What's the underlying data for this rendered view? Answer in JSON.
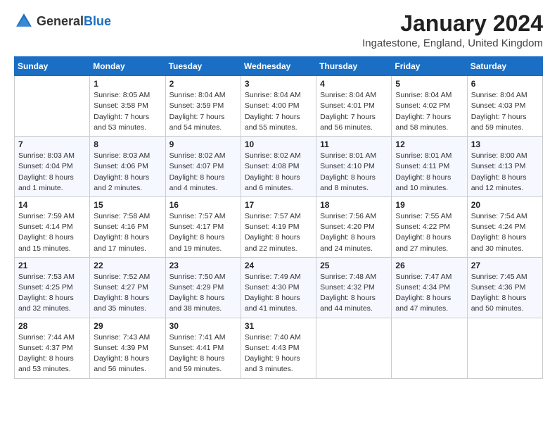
{
  "header": {
    "logo_general": "General",
    "logo_blue": "Blue",
    "month_title": "January 2024",
    "location": "Ingatestone, England, United Kingdom"
  },
  "calendar": {
    "days_of_week": [
      "Sunday",
      "Monday",
      "Tuesday",
      "Wednesday",
      "Thursday",
      "Friday",
      "Saturday"
    ],
    "weeks": [
      [
        {
          "day": "",
          "info": ""
        },
        {
          "day": "1",
          "info": "Sunrise: 8:05 AM\nSunset: 3:58 PM\nDaylight: 7 hours\nand 53 minutes."
        },
        {
          "day": "2",
          "info": "Sunrise: 8:04 AM\nSunset: 3:59 PM\nDaylight: 7 hours\nand 54 minutes."
        },
        {
          "day": "3",
          "info": "Sunrise: 8:04 AM\nSunset: 4:00 PM\nDaylight: 7 hours\nand 55 minutes."
        },
        {
          "day": "4",
          "info": "Sunrise: 8:04 AM\nSunset: 4:01 PM\nDaylight: 7 hours\nand 56 minutes."
        },
        {
          "day": "5",
          "info": "Sunrise: 8:04 AM\nSunset: 4:02 PM\nDaylight: 7 hours\nand 58 minutes."
        },
        {
          "day": "6",
          "info": "Sunrise: 8:04 AM\nSunset: 4:03 PM\nDaylight: 7 hours\nand 59 minutes."
        }
      ],
      [
        {
          "day": "7",
          "info": "Sunrise: 8:03 AM\nSunset: 4:04 PM\nDaylight: 8 hours\nand 1 minute."
        },
        {
          "day": "8",
          "info": "Sunrise: 8:03 AM\nSunset: 4:06 PM\nDaylight: 8 hours\nand 2 minutes."
        },
        {
          "day": "9",
          "info": "Sunrise: 8:02 AM\nSunset: 4:07 PM\nDaylight: 8 hours\nand 4 minutes."
        },
        {
          "day": "10",
          "info": "Sunrise: 8:02 AM\nSunset: 4:08 PM\nDaylight: 8 hours\nand 6 minutes."
        },
        {
          "day": "11",
          "info": "Sunrise: 8:01 AM\nSunset: 4:10 PM\nDaylight: 8 hours\nand 8 minutes."
        },
        {
          "day": "12",
          "info": "Sunrise: 8:01 AM\nSunset: 4:11 PM\nDaylight: 8 hours\nand 10 minutes."
        },
        {
          "day": "13",
          "info": "Sunrise: 8:00 AM\nSunset: 4:13 PM\nDaylight: 8 hours\nand 12 minutes."
        }
      ],
      [
        {
          "day": "14",
          "info": "Sunrise: 7:59 AM\nSunset: 4:14 PM\nDaylight: 8 hours\nand 15 minutes."
        },
        {
          "day": "15",
          "info": "Sunrise: 7:58 AM\nSunset: 4:16 PM\nDaylight: 8 hours\nand 17 minutes."
        },
        {
          "day": "16",
          "info": "Sunrise: 7:57 AM\nSunset: 4:17 PM\nDaylight: 8 hours\nand 19 minutes."
        },
        {
          "day": "17",
          "info": "Sunrise: 7:57 AM\nSunset: 4:19 PM\nDaylight: 8 hours\nand 22 minutes."
        },
        {
          "day": "18",
          "info": "Sunrise: 7:56 AM\nSunset: 4:20 PM\nDaylight: 8 hours\nand 24 minutes."
        },
        {
          "day": "19",
          "info": "Sunrise: 7:55 AM\nSunset: 4:22 PM\nDaylight: 8 hours\nand 27 minutes."
        },
        {
          "day": "20",
          "info": "Sunrise: 7:54 AM\nSunset: 4:24 PM\nDaylight: 8 hours\nand 30 minutes."
        }
      ],
      [
        {
          "day": "21",
          "info": "Sunrise: 7:53 AM\nSunset: 4:25 PM\nDaylight: 8 hours\nand 32 minutes."
        },
        {
          "day": "22",
          "info": "Sunrise: 7:52 AM\nSunset: 4:27 PM\nDaylight: 8 hours\nand 35 minutes."
        },
        {
          "day": "23",
          "info": "Sunrise: 7:50 AM\nSunset: 4:29 PM\nDaylight: 8 hours\nand 38 minutes."
        },
        {
          "day": "24",
          "info": "Sunrise: 7:49 AM\nSunset: 4:30 PM\nDaylight: 8 hours\nand 41 minutes."
        },
        {
          "day": "25",
          "info": "Sunrise: 7:48 AM\nSunset: 4:32 PM\nDaylight: 8 hours\nand 44 minutes."
        },
        {
          "day": "26",
          "info": "Sunrise: 7:47 AM\nSunset: 4:34 PM\nDaylight: 8 hours\nand 47 minutes."
        },
        {
          "day": "27",
          "info": "Sunrise: 7:45 AM\nSunset: 4:36 PM\nDaylight: 8 hours\nand 50 minutes."
        }
      ],
      [
        {
          "day": "28",
          "info": "Sunrise: 7:44 AM\nSunset: 4:37 PM\nDaylight: 8 hours\nand 53 minutes."
        },
        {
          "day": "29",
          "info": "Sunrise: 7:43 AM\nSunset: 4:39 PM\nDaylight: 8 hours\nand 56 minutes."
        },
        {
          "day": "30",
          "info": "Sunrise: 7:41 AM\nSunset: 4:41 PM\nDaylight: 8 hours\nand 59 minutes."
        },
        {
          "day": "31",
          "info": "Sunrise: 7:40 AM\nSunset: 4:43 PM\nDaylight: 9 hours\nand 3 minutes."
        },
        {
          "day": "",
          "info": ""
        },
        {
          "day": "",
          "info": ""
        },
        {
          "day": "",
          "info": ""
        }
      ]
    ]
  }
}
